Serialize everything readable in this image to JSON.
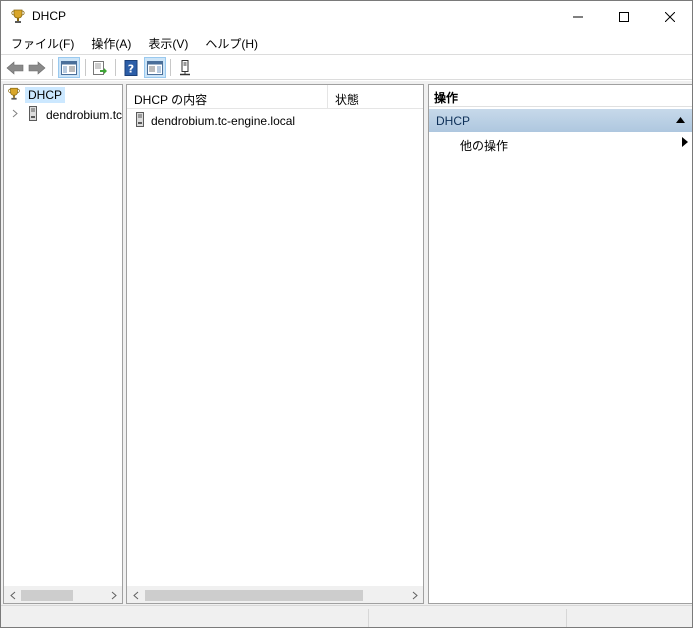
{
  "window": {
    "title": "DHCP",
    "app_icon": "dhcp-trophy-icon",
    "controls": {
      "minimize": "—",
      "maximize": "☐",
      "close": "✕"
    }
  },
  "menu": {
    "items": [
      {
        "label": "ファイル(F)"
      },
      {
        "label": "操作(A)"
      },
      {
        "label": "表示(V)"
      },
      {
        "label": "ヘルプ(H)"
      }
    ]
  },
  "toolbar": {
    "buttons": [
      {
        "icon": "back-arrow-icon"
      },
      {
        "icon": "forward-arrow-icon"
      },
      {
        "icon": "show-hide-console-tree-icon"
      },
      {
        "icon": "export-list-icon"
      },
      {
        "icon": "help-icon"
      },
      {
        "icon": "show-hide-action-pane-icon"
      },
      {
        "icon": "server-icon"
      }
    ]
  },
  "tree": {
    "root_label": "DHCP",
    "child_label": "dendrobium.tc-engine.local"
  },
  "list": {
    "columns": [
      "DHCP の内容",
      "状態"
    ],
    "rows": [
      {
        "name": "dendrobium.tc-engine.local",
        "status": ""
      }
    ]
  },
  "actions": {
    "header": "操作",
    "section_title": "DHCP",
    "items": [
      {
        "label": "他の操作"
      }
    ]
  },
  "colors": {
    "selection": "#cce8ff",
    "action_section": "#b9cfe4",
    "toolbar_active": "#cce4f7"
  }
}
